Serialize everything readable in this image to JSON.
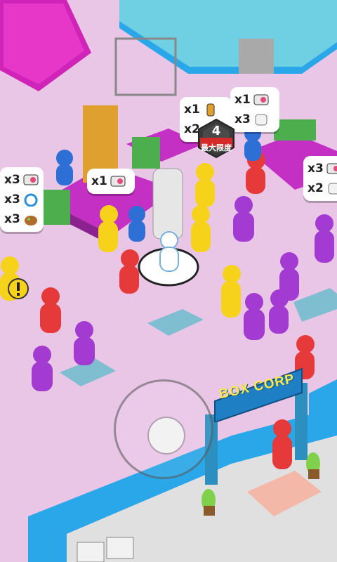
{
  "bubbles": {
    "left": {
      "rows": [
        {
          "qty": "x3",
          "icon": "radio-icon"
        },
        {
          "qty": "x3",
          "icon": "clock-icon"
        },
        {
          "qty": "x3",
          "icon": "bag-icon"
        }
      ]
    },
    "center_left": {
      "rows": [
        {
          "qty": "x1",
          "icon": "radio-icon"
        }
      ]
    },
    "top_mid": {
      "rows": [
        {
          "qty": "x1",
          "icon": "bottle-icon"
        },
        {
          "qty": "x2",
          "icon": "toilet-paper-icon"
        }
      ]
    },
    "top_right": {
      "rows": [
        {
          "qty": "x1",
          "icon": "radio-icon"
        },
        {
          "qty": "x3",
          "icon": "toilet-paper-icon"
        }
      ]
    },
    "right": {
      "rows": [
        {
          "qty": "x3",
          "icon": "radio-icon"
        },
        {
          "qty": "x2",
          "icon": "toilet-paper-icon"
        }
      ]
    }
  },
  "carry_limit": {
    "value": "4",
    "label": "最大限度"
  },
  "gate": {
    "sign": "BOX CORP"
  },
  "colors": {
    "floor": "#e9c6e6",
    "wall": "#2aa7e8",
    "desk": "#d93ad9",
    "yellow": "#f6d21a",
    "red": "#e63a3a",
    "purple": "#a33ad1",
    "blue": "#2e6fd6"
  }
}
